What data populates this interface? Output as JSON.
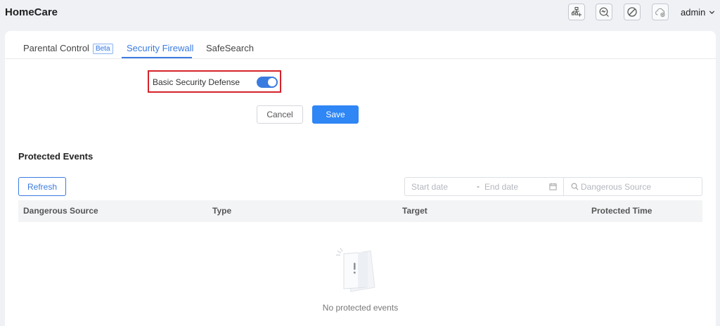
{
  "app": {
    "title": "HomeCare"
  },
  "topbar": {
    "icons": [
      "network-topology-icon",
      "diagnosis-search-icon",
      "blocked-icon",
      "cloud-disconnected-icon"
    ],
    "user": "admin"
  },
  "tabs": [
    {
      "label": "Parental Control",
      "badge": "Beta",
      "active": false
    },
    {
      "label": "Security Firewall",
      "active": true
    },
    {
      "label": "SafeSearch",
      "active": false
    }
  ],
  "defense": {
    "label": "Basic Security Defense",
    "enabled": true
  },
  "actions": {
    "cancel": "Cancel",
    "save": "Save"
  },
  "events": {
    "title": "Protected Events",
    "refresh": "Refresh",
    "start_placeholder": "Start date",
    "separator": "-",
    "end_placeholder": "End date",
    "search_placeholder": "Dangerous Source",
    "columns": [
      "Dangerous Source",
      "Type",
      "Target",
      "Protected Time"
    ],
    "rows": [],
    "empty_text": "No protected events"
  },
  "colors": {
    "accent": "#3a7be0",
    "primary_button": "#2f86f5",
    "highlight": "#d5232a"
  }
}
